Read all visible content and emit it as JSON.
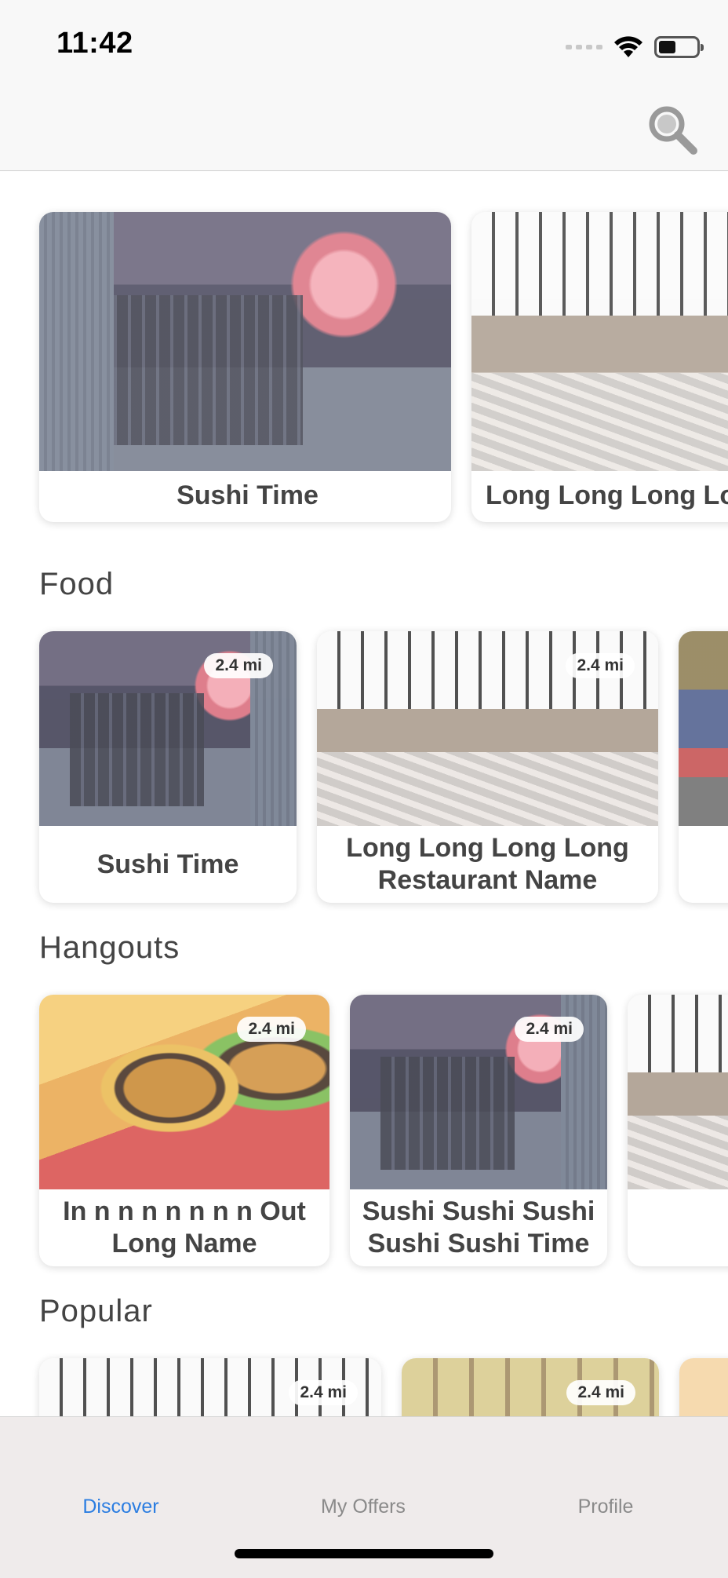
{
  "status_bar": {
    "time": "11:42",
    "battery_level": 0.45
  },
  "nav": {
    "search_icon": "magnifier-icon"
  },
  "featured": [
    {
      "name": "Sushi Time"
    },
    {
      "name": "Long Long Long Lo"
    }
  ],
  "sections": [
    {
      "title": "Food",
      "items": [
        {
          "name": "Sushi Time",
          "distance": "2.4 mi"
        },
        {
          "name": "Long Long Long Long Restaurant Name",
          "distance": "2.4 mi"
        },
        {
          "name": "",
          "distance": ""
        }
      ]
    },
    {
      "title": "Hangouts",
      "items": [
        {
          "name": "In n n n n n n n Out Long Name",
          "distance": "2.4 mi"
        },
        {
          "name": "Sushi Sushi Sushi Sushi Sushi Time",
          "distance": "2.4 mi"
        },
        {
          "name": "",
          "distance": ""
        }
      ]
    },
    {
      "title": "Popular",
      "items": [
        {
          "name": "",
          "distance": "2.4 mi"
        },
        {
          "name": "",
          "distance": "2.4 mi"
        },
        {
          "name": "",
          "distance": ""
        }
      ]
    }
  ],
  "tabs": [
    {
      "label": "Discover",
      "active": true
    },
    {
      "label": "My Offers",
      "active": false
    },
    {
      "label": "Profile",
      "active": false
    }
  ],
  "colors": {
    "accent": "#2b7de1",
    "tab_inactive": "#8a8a8a"
  }
}
